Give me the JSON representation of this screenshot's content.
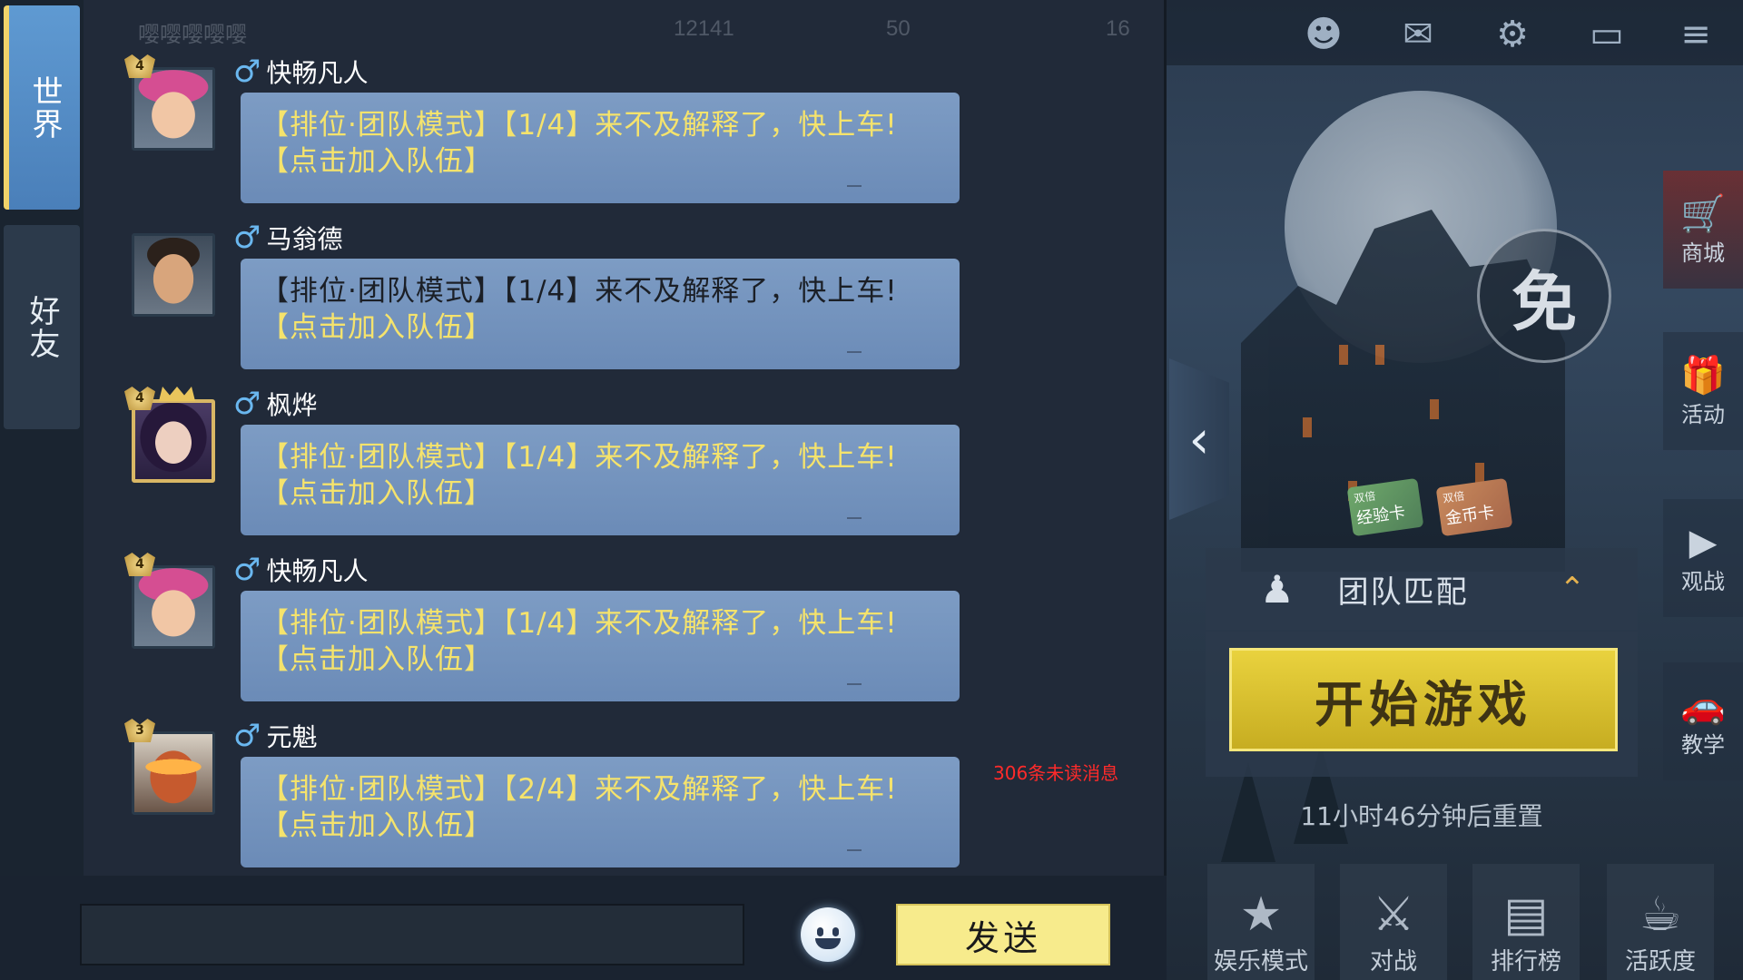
{
  "tabs": [
    {
      "label": "世界",
      "active": true
    },
    {
      "label": "好友",
      "active": false
    }
  ],
  "messages": [
    {
      "name": "快畅凡人",
      "rank": "4",
      "avatar": "pink-girl",
      "line1": "【排位·团队模式】【1/4】来不及解释了，快上车!",
      "line2": "【点击加入队伍】",
      "line1_color": "yellow"
    },
    {
      "name": "马翁德",
      "rank": "",
      "avatar": "man",
      "line1": "【排位·团队模式】【1/4】来不及解释了，快上车!",
      "line2": "【点击加入队伍】",
      "line1_color": "dark"
    },
    {
      "name": "枫烨",
      "rank": "4",
      "avatar": "dark-girl",
      "line1": "【排位·团队模式】【1/4】来不及解释了，快上车!",
      "line2": "【点击加入队伍】",
      "line1_color": "yellow"
    },
    {
      "name": "快畅凡人",
      "rank": "4",
      "avatar": "pink-girl",
      "line1": "【排位·团队模式】【1/4】来不及解释了，快上车!",
      "line2": "【点击加入队伍】",
      "line1_color": "yellow"
    },
    {
      "name": "元魁",
      "rank": "3",
      "avatar": "robot",
      "line1": "【排位·团队模式】【2/4】来不及解释了，快上车!",
      "line2": "【点击加入队伍】",
      "line1_color": "yellow"
    }
  ],
  "unread": "306条未读消息",
  "input": {
    "placeholder": ""
  },
  "send_label": "发送",
  "background_faded": {
    "top_name": "嘤嘤嘤嘤嘤",
    "top_value1": "12141",
    "top_value2": "50",
    "top_value3": "16"
  },
  "right_menu": [
    {
      "label": "商城",
      "icon": "cart-icon"
    },
    {
      "label": "活动",
      "icon": "gift-icon"
    },
    {
      "label": "观战",
      "icon": "play-icon"
    },
    {
      "label": "教学",
      "icon": "car-icon"
    }
  ],
  "free_label": "免",
  "cards": [
    {
      "tag": "双倍",
      "label": "经验卡"
    },
    {
      "tag": "双倍",
      "label": "金币卡"
    }
  ],
  "match_mode": "团队匹配",
  "start_label": "开始游戏",
  "reset_text": "11小时46分钟后重置",
  "bottom_nav": [
    {
      "label": "娱乐模式",
      "icon": "star-icon"
    },
    {
      "label": "对战",
      "icon": "swords-icon"
    },
    {
      "label": "排行榜",
      "icon": "podium-icon"
    },
    {
      "label": "活跃度",
      "icon": "mug-icon"
    }
  ],
  "colors": {
    "bubble": "#7393bd",
    "send": "#f7eb8c",
    "start": "#e9d23e",
    "unread": "#ff2a2a",
    "tab_active": "#5f9ad2"
  }
}
